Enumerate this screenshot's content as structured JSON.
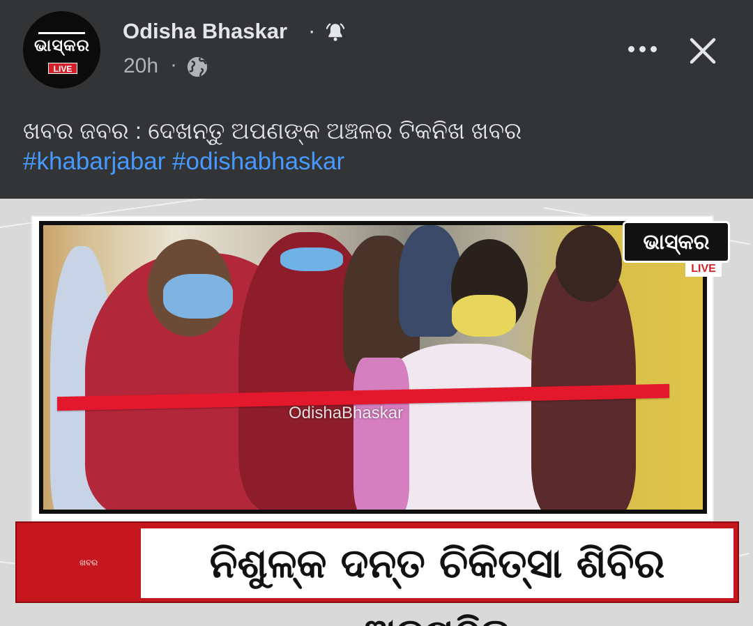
{
  "post": {
    "page_name": "Odisha Bhaskar",
    "name_separator": "·",
    "time": "20h",
    "time_separator": "·",
    "caption": "ଖବର ଜବର : ଦେଖନ୍ତୁ ଅପଣଙ୍କ ଅଞ୍ଚଳର ଟିକନିଖ ଖବର",
    "hashtags": [
      "#khabarjabar",
      "#odishabhaskar"
    ]
  },
  "avatar": {
    "logo_text": "ଭାସ୍କର",
    "live_label": "LIVE"
  },
  "icons": {
    "bell": "bell-icon",
    "globe": "globe-icon",
    "more": "more-horizontal-icon",
    "close": "close-icon"
  },
  "media": {
    "watermark": "OdishaBhaskar",
    "channel_logo_text": "ଭାସ୍କର",
    "channel_live_label": "LIVE",
    "lower_third_tag": "ଖବର",
    "headline": "ନିଶୁଳ୍କ ଦନ୍ତ ଚିକିତ୍ସା  ଶିବିର ଅନୁଷ୍ଠିତ"
  },
  "colors": {
    "header_bg": "#333435",
    "link": "#4599ff",
    "live_red": "#d1202a",
    "ribbon_red": "#e4182c",
    "lower_third_red": "#c4161c"
  }
}
